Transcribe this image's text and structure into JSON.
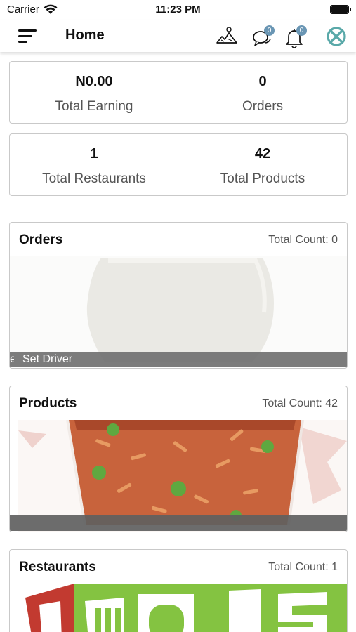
{
  "status_bar": {
    "carrier": "Carrier",
    "time": "11:23 PM"
  },
  "nav": {
    "title": "Home",
    "messages_badge": "0",
    "notifications_badge": "0",
    "accent_color": "#5aa9a9"
  },
  "stats": [
    {
      "value": "N0.00",
      "label": "Total Earning"
    },
    {
      "value": "0",
      "label": "Orders"
    },
    {
      "value": "1",
      "label": "Total Restaurants"
    },
    {
      "value": "42",
      "label": "Total Products"
    }
  ],
  "sections": {
    "orders": {
      "title": "Orders",
      "count_label": "Total Count: 0",
      "overlay_clip": "e",
      "overlay_label": "Set Driver"
    },
    "products": {
      "title": "Products",
      "count_label": "Total Count: 42"
    },
    "restaurants": {
      "title": "Restaurants",
      "count_label": "Total Count: 1"
    }
  },
  "icons": {
    "menu": "menu-icon",
    "map": "map-icon",
    "messages": "chat-icon",
    "notifications": "bell-icon",
    "logo": "app-logo-icon"
  }
}
